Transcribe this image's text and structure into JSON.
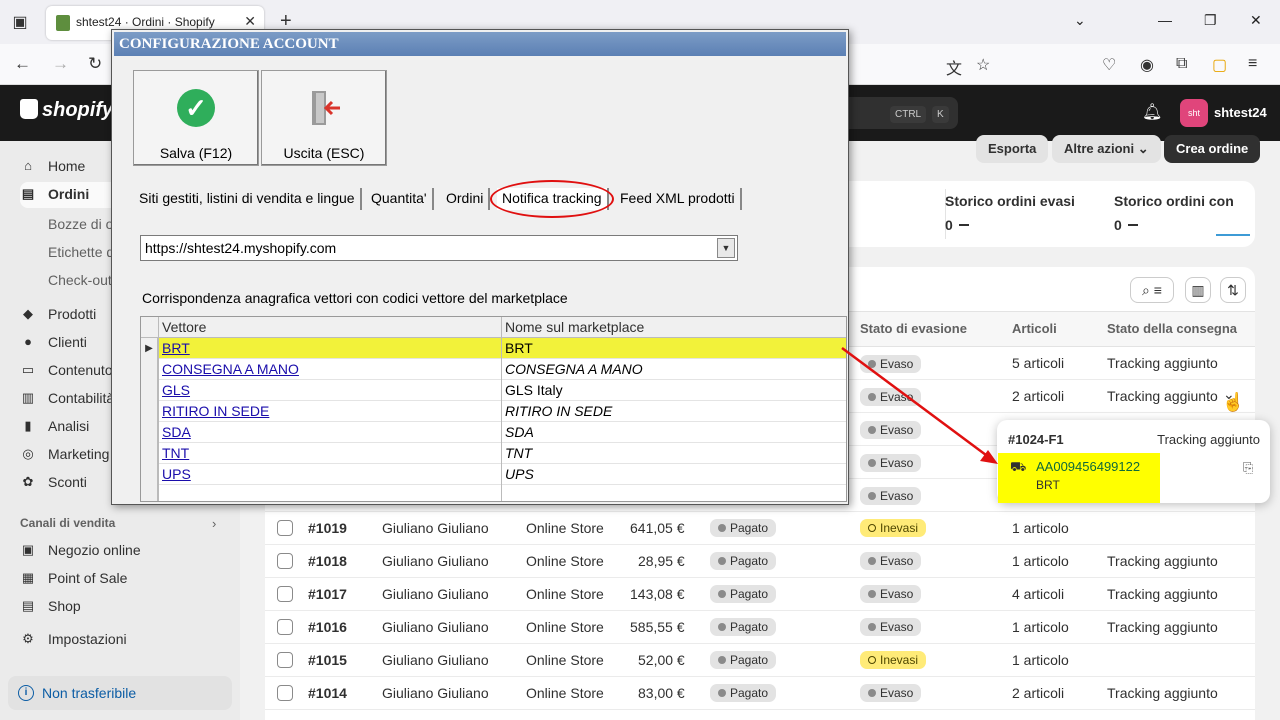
{
  "browser": {
    "tab_title": "shtest24 · Ordini · Shopify",
    "new_tab": "+"
  },
  "shop": {
    "logo": "shopify",
    "shortcut_ctrl": "CTRL",
    "shortcut_k": "K",
    "avatar": "sht",
    "store_name": "shtest24"
  },
  "sidebar": {
    "items": [
      {
        "label": "Home",
        "icon": "home-icon"
      },
      {
        "label": "Ordini",
        "icon": "orders-icon"
      },
      {
        "label": "Prodotti",
        "icon": "tag-icon"
      },
      {
        "label": "Clienti",
        "icon": "person-icon"
      },
      {
        "label": "Contenuto",
        "icon": "content-icon"
      },
      {
        "label": "Contabilità",
        "icon": "bank-icon"
      },
      {
        "label": "Analisi",
        "icon": "chart-icon"
      },
      {
        "label": "Marketing",
        "icon": "target-icon"
      },
      {
        "label": "Sconti",
        "icon": "discount-icon"
      }
    ],
    "sub_items": [
      "Bozze di o",
      "Etichette d",
      "Check-out"
    ],
    "section_title": "Canali di vendita",
    "channels": [
      {
        "label": "Negozio online"
      },
      {
        "label": "Point of Sale"
      },
      {
        "label": "Shop"
      }
    ],
    "settings": "Impostazioni",
    "non_transferable": "Non trasferibile"
  },
  "actions": {
    "export": "Esporta",
    "more": "Altre azioni",
    "create": "Crea ordine"
  },
  "stats": [
    {
      "title": "Storico ordini evasi",
      "value": "0"
    },
    {
      "title": "Storico ordini con",
      "value": "0"
    }
  ],
  "table": {
    "headers": {
      "fulfillment": "Stato di evasione",
      "items": "Articoli",
      "delivery": "Stato della consegna"
    },
    "upper_rows": [
      {
        "fulfillment": "Evaso",
        "items": "5 articoli",
        "delivery": "Tracking aggiunto"
      },
      {
        "fulfillment": "Evaso",
        "items": "2 articoli",
        "delivery": "Tracking aggiunto"
      },
      {
        "fulfillment": "Evaso",
        "items": "",
        "delivery": ""
      },
      {
        "fulfillment": "Evaso",
        "items": "",
        "delivery": ""
      },
      {
        "fulfillment": "Evaso",
        "items": "",
        "delivery": ""
      }
    ],
    "rows": [
      {
        "order": "#1019",
        "customer": "Giuliano Giuliano",
        "channel": "Online Store",
        "total": "641,05 €",
        "payment": "Pagato",
        "fulfillment": "Inevasi",
        "items": "1 articolo",
        "delivery": ""
      },
      {
        "order": "#1018",
        "customer": "Giuliano Giuliano",
        "channel": "Online Store",
        "total": "28,95 €",
        "payment": "Pagato",
        "fulfillment": "Evaso",
        "items": "1 articolo",
        "delivery": "Tracking aggiunto"
      },
      {
        "order": "#1017",
        "customer": "Giuliano Giuliano",
        "channel": "Online Store",
        "total": "143,08 €",
        "payment": "Pagato",
        "fulfillment": "Evaso",
        "items": "4 articoli",
        "delivery": "Tracking aggiunto"
      },
      {
        "order": "#1016",
        "customer": "Giuliano Giuliano",
        "channel": "Online Store",
        "total": "585,55 €",
        "payment": "Pagato",
        "fulfillment": "Evaso",
        "items": "1 articolo",
        "delivery": "Tracking aggiunto"
      },
      {
        "order": "#1015",
        "customer": "Giuliano Giuliano",
        "channel": "Online Store",
        "total": "52,00 €",
        "payment": "Pagato",
        "fulfillment": "Inevasi",
        "items": "1 articolo",
        "delivery": ""
      },
      {
        "order": "#1014",
        "customer": "Giuliano Giuliano",
        "channel": "Online Store",
        "total": "83,00 €",
        "payment": "Pagato",
        "fulfillment": "Evaso",
        "items": "2 articoli",
        "delivery": "Tracking aggiunto"
      }
    ]
  },
  "popover": {
    "order_id": "#1024-F1",
    "status": "Tracking aggiunto",
    "tracking": "AA009456499122",
    "carrier": "BRT"
  },
  "dialog": {
    "title": "CONFIGURAZIONE ACCOUNT",
    "save": "Salva (F12)",
    "exit": "Uscita (ESC)",
    "tabs": [
      "Siti gestiti, listini di vendita e lingue",
      "Quantita'",
      "Ordini",
      "Notifica tracking",
      "Feed XML prodotti"
    ],
    "url": "https://shtest24.myshopify.com",
    "caption": "Corrispondenza anagrafica vettori con codici vettore del marketplace",
    "grid_headers": {
      "carrier": "Vettore",
      "marketplace": "Nome sul marketplace"
    },
    "grid_rows": [
      {
        "carrier": "BRT",
        "marketplace": "BRT"
      },
      {
        "carrier": "CONSEGNA A MANO",
        "marketplace": "CONSEGNA A MANO"
      },
      {
        "carrier": "GLS",
        "marketplace": "GLS Italy"
      },
      {
        "carrier": "RITIRO IN SEDE",
        "marketplace": "RITIRO IN SEDE"
      },
      {
        "carrier": "SDA",
        "marketplace": "SDA"
      },
      {
        "carrier": "TNT",
        "marketplace": "TNT"
      },
      {
        "carrier": "UPS",
        "marketplace": "UPS"
      }
    ]
  }
}
